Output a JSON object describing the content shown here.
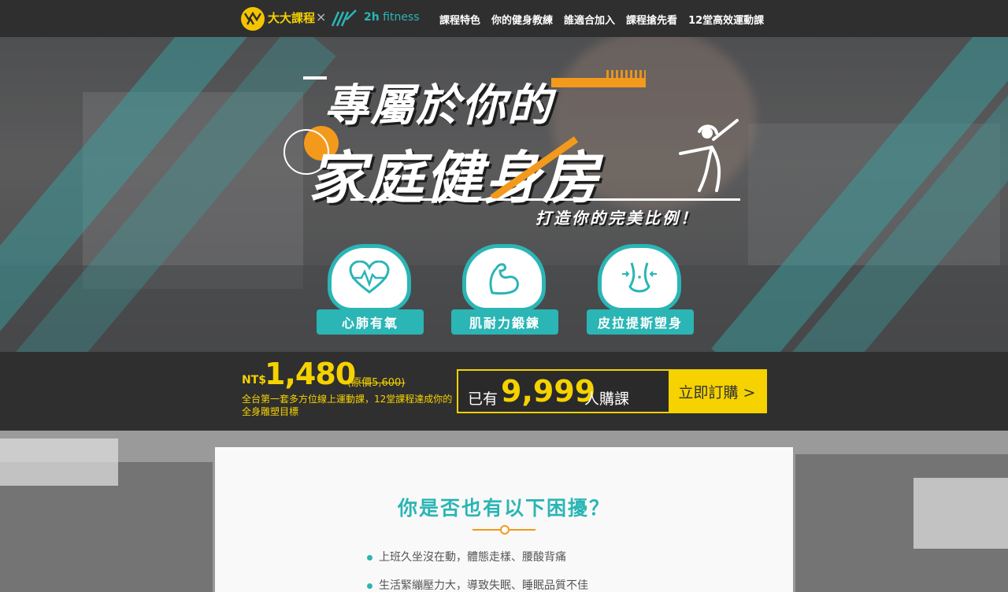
{
  "nav": {
    "brand_primary": "大大課程",
    "separator": "×",
    "brand_partner_prefix": "2h",
    "brand_partner_suffix": "fitness",
    "menu": [
      "課程特色",
      "你的健身教練",
      "誰適合加入",
      "課程搶先看",
      "12堂高效運動課"
    ]
  },
  "hero": {
    "title_line1": "專屬於你的",
    "title_line2": "家庭健身房",
    "subtitle": "打造你的完美比例！",
    "features": [
      {
        "label": "心肺有氧",
        "icon": "heart-pulse-icon"
      },
      {
        "label": "肌耐力鍛鍊",
        "icon": "bicep-icon"
      },
      {
        "label": "皮拉提斯塑身",
        "icon": "waist-icon"
      }
    ]
  },
  "pricing": {
    "currency": "NT$",
    "price": "1,480",
    "original_price": "(原價5,600)",
    "description": "全台第一套多方位線上運動課，12堂課程達成你的全身雕塑目標",
    "bought_prefix": "已有",
    "bought_count": "9,999",
    "bought_suffix": "人購課",
    "buy_button": "立即訂購 >"
  },
  "problems": {
    "title": "你是否也有以下困擾？",
    "items": [
      "上班久坐沒在動，體態走樣、腰酸背痛",
      "生活緊繃壓力大，導致失眠、睡眠品質不佳"
    ]
  },
  "colors": {
    "accent": "#2bb5b5",
    "highlight": "#f5d200",
    "orange": "#f39a1c",
    "dark": "#2f2f2f"
  }
}
